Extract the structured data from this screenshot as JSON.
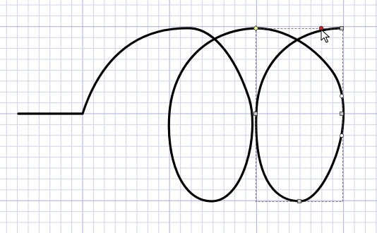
{
  "editor": {
    "tool": "node-editor",
    "cursor_icon": "arrow-pointer-icon"
  },
  "colors": {
    "background": "#ffffff",
    "grid_minor": "#cfd3ea",
    "grid_major": "#a9aedd",
    "path_stroke": "#000000",
    "bbox_stroke": "#555555",
    "node_fill": "#c8c8c8",
    "node_start_fill": "#f2f28a",
    "node_end_fill": "#d81f1f",
    "handle_fill": "#ffffff"
  }
}
